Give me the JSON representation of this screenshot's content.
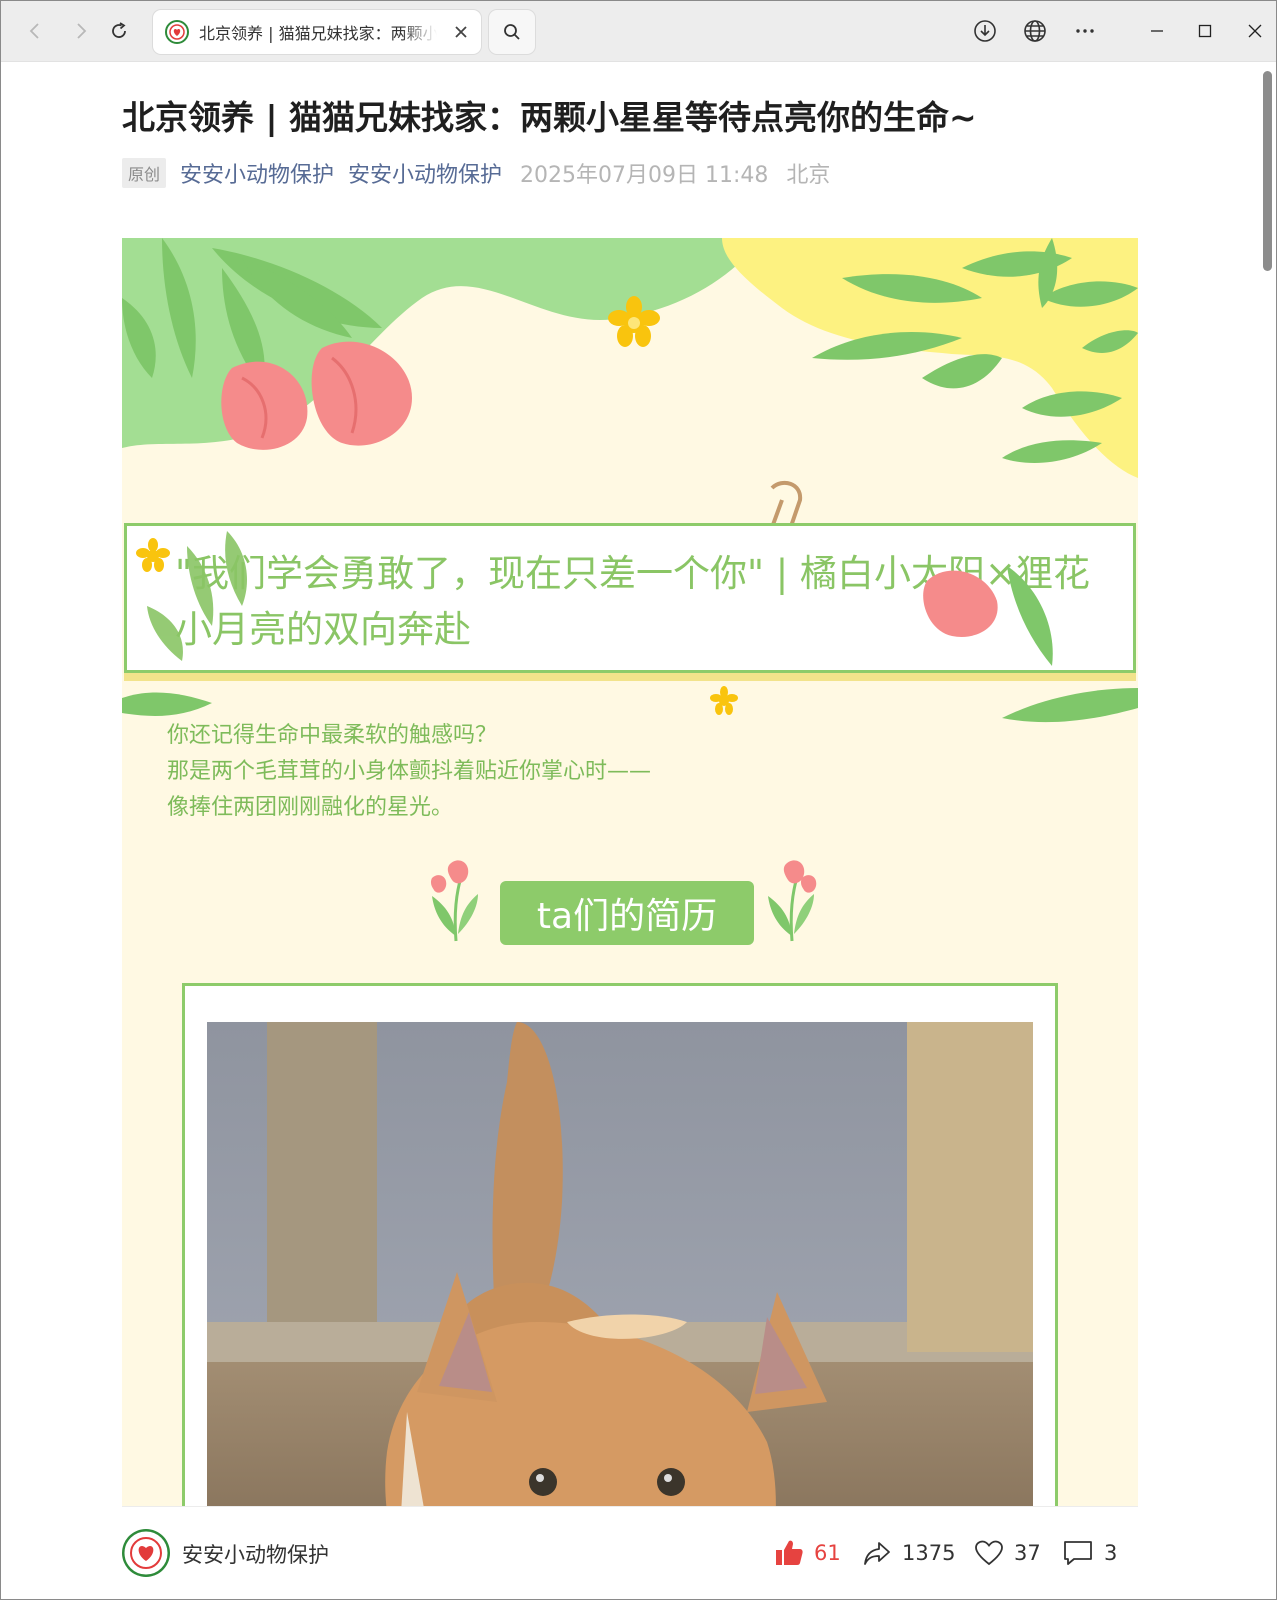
{
  "browser": {
    "tab_title": "北京领养 | 猫猫兄妹找家：两颗小星星等待点亮你的生命~",
    "icons": [
      "back-icon",
      "forward-icon",
      "reload-icon",
      "close-icon",
      "search-icon",
      "download-icon",
      "globe-icon",
      "more-icon",
      "minimize-icon",
      "maximize-icon",
      "window-close-icon"
    ]
  },
  "article": {
    "title": "北京领养 | 猫猫兄妹找家：两颗小星星等待点亮你的生命~",
    "original_badge": "原创",
    "author_account": "安安小动物保护",
    "author_name": "安安小动物保护",
    "publish_time": "2025年07月09日 11:48",
    "location": "北京"
  },
  "poster": {
    "banner_text": "\"我们学会勇敢了，现在只差一个你\" | 橘白小太阳×狸花小月亮的双向奔赴",
    "intro_lines": [
      "你还记得生命中最柔软的触感吗？",
      "那是两个毛茸茸的小身体颤抖着贴近你掌心时——",
      "像捧住两团刚刚融化的星光。"
    ],
    "section_label": "ta们的简历"
  },
  "footer": {
    "account_name": "安安小动物保护",
    "likes": "61",
    "shares": "1375",
    "favorites": "37",
    "comments": "3"
  },
  "colors": {
    "accent_green": "#8dcb6a",
    "text_green": "#7ebb5a",
    "link_blue": "#576b95",
    "like_red": "#e64340",
    "poster_bg": "#fff9e3"
  }
}
